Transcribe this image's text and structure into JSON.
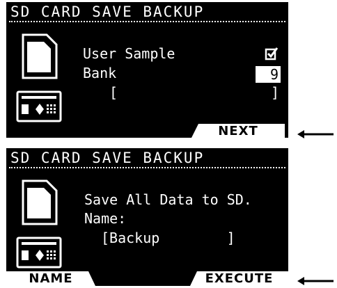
{
  "screen1": {
    "title": "SD CARD SAVE BACKUP",
    "user_sample_label": "User Sample",
    "user_sample_checked": true,
    "bank_label": "Bank",
    "bank_value": "9",
    "bracket_open": "[",
    "bracket_close": "]",
    "next_label": "NEXT"
  },
  "screen2": {
    "title": "SD CARD SAVE BACKUP",
    "message": "Save All Data to SD.",
    "name_label": "Name:",
    "name_field": "[Backup        ]",
    "name_button_label": "NAME",
    "execute_label": "EXECUTE"
  },
  "icons": [
    "sd-card-icon",
    "device-icon",
    "checkbox-icon",
    "arrow-left-icon"
  ],
  "colors": {
    "screen_bg": "#000000",
    "screen_fg": "#ffffff",
    "page_bg": "#ffffff"
  }
}
